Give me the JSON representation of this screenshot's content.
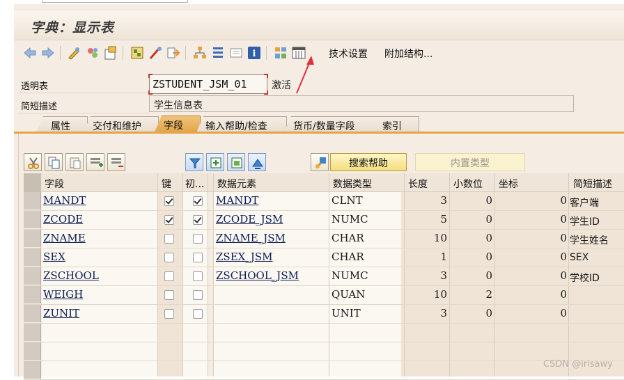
{
  "window": {
    "title": "字典：显示表"
  },
  "toolbar": {
    "icons": [
      "back-arrow-icon",
      "forward-arrow-icon",
      "toggle-display-change-icon",
      "other-object-icon",
      "activate-icon",
      "check-icon",
      "where-used-icon",
      "object-list-icon",
      "hierarchy-icon",
      "info-icon",
      "columns-icon",
      "technical-settings-icon"
    ],
    "tech_settings_label": "技术设置",
    "append_structure_label": "附加结构..."
  },
  "header": {
    "table_label": "透明表",
    "table_name": "ZSTUDENT_JSM_01",
    "status": "激活",
    "desc_label": "简短描述",
    "description": "学生信息表"
  },
  "tabs": [
    {
      "label": "属性"
    },
    {
      "label": "交付和维护"
    },
    {
      "label": "字段",
      "active": true
    },
    {
      "label": "输入帮助/检查"
    },
    {
      "label": "货币/数量字段"
    },
    {
      "label": "索引"
    }
  ],
  "buttons": {
    "search_help": "搜索帮助",
    "builtin_type": "内置类型"
  },
  "grid": {
    "headers": {
      "field": "字段",
      "key": "键",
      "initial": "初...",
      "data_element": "数据元素",
      "data_type": "数据类型",
      "length": "长度",
      "decimals": "小数位",
      "coordinate": "坐标",
      "short_desc": "简短描述"
    },
    "rows": [
      {
        "field": "MANDT",
        "key": true,
        "initial": true,
        "data_element": "MANDT",
        "data_type": "CLNT",
        "length": "3",
        "decimals": "0",
        "coordinate": "0",
        "short_desc": "客户端"
      },
      {
        "field": "ZCODE",
        "key": true,
        "initial": true,
        "data_element": "ZCODE_JSM",
        "data_type": "NUMC",
        "length": "5",
        "decimals": "0",
        "coordinate": "0",
        "short_desc": "学生ID"
      },
      {
        "field": "ZNAME",
        "key": false,
        "initial": false,
        "data_element": "ZNAME_JSM",
        "data_type": "CHAR",
        "length": "10",
        "decimals": "0",
        "coordinate": "0",
        "short_desc": "学生姓名"
      },
      {
        "field": "SEX",
        "key": false,
        "initial": false,
        "data_element": "ZSEX_JSM",
        "data_type": "CHAR",
        "length": "1",
        "decimals": "0",
        "coordinate": "0",
        "short_desc": "SEX"
      },
      {
        "field": "ZSCHOOL",
        "key": false,
        "initial": false,
        "data_element": "ZSCHOOL_JSM",
        "data_type": "NUMC",
        "length": "3",
        "decimals": "0",
        "coordinate": "0",
        "short_desc": "学校ID"
      },
      {
        "field": "WEIGH",
        "key": false,
        "initial": false,
        "data_element": "",
        "data_type": "QUAN",
        "length": "10",
        "decimals": "2",
        "coordinate": "0",
        "short_desc": ""
      },
      {
        "field": "ZUNIT",
        "key": false,
        "initial": false,
        "data_element": "",
        "data_type": "UNIT",
        "length": "3",
        "decimals": "0",
        "coordinate": "0",
        "short_desc": ""
      }
    ]
  },
  "watermark": "CSDN @irisawy",
  "colors": {
    "active_tab": "#e2a54a",
    "frame_bg": "#f5ede3",
    "annotation_arrow": "#e0303e"
  }
}
